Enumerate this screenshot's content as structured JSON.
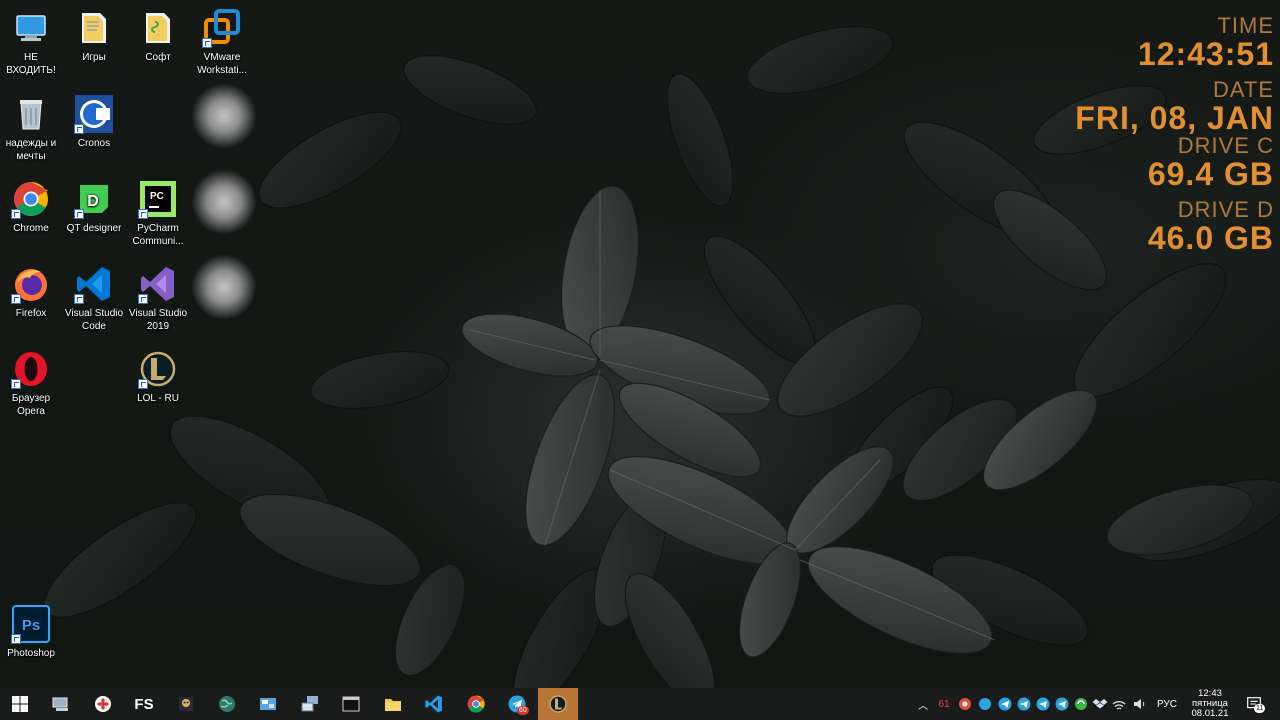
{
  "desktop": {
    "icons": [
      {
        "label": "НЕ ВХОДИТЬ!",
        "icon": "computer-icon"
      },
      {
        "label": "надежды и мечты",
        "icon": "recycle-bin-icon"
      },
      {
        "label": "Chrome",
        "icon": "chrome-icon"
      },
      {
        "label": "Firefox",
        "icon": "firefox-icon"
      },
      {
        "label": "Браузер Opera",
        "icon": "opera-icon"
      },
      {
        "label": "Photoshop",
        "icon": "photoshop-icon"
      },
      {
        "label": "Игры",
        "icon": "folder-icon"
      },
      {
        "label": "Cronos",
        "icon": "cronos-icon"
      },
      {
        "label": "QT designer",
        "icon": "qt-designer-icon"
      },
      {
        "label": "Visual Studio Code",
        "icon": "vscode-icon"
      },
      {
        "label": "Софт",
        "icon": "folder-icon"
      },
      {
        "label": "PyCharm Communi...",
        "icon": "pycharm-icon"
      },
      {
        "label": "Visual Studio 2019",
        "icon": "visual-studio-icon"
      },
      {
        "label": "LOL - RU",
        "icon": "league-of-legends-icon"
      },
      {
        "label": "VMware Workstati...",
        "icon": "vmware-icon"
      }
    ]
  },
  "widget": {
    "time_label": "TIME",
    "time_value": "12:43:51",
    "date_label": "DATE",
    "date_value": "FRI, 08, JAN",
    "drive_c_label": "DRIVE C",
    "drive_c_value": "69.4 GB",
    "drive_d_label": "DRIVE D",
    "drive_d_value": "46.0 GB"
  },
  "taskbar": {
    "fs_label": "FS",
    "telegram_badge": "60",
    "tray_count": "61",
    "language": "РУС",
    "clock_time": "12:43",
    "clock_day": "пятница",
    "clock_date": "08.01.21",
    "notification_count": "11"
  },
  "colors": {
    "widget_label": "#b2793b",
    "widget_value": "#e38f2d",
    "taskbar_bg": "#1a1c1b",
    "active_app": "#b87435"
  }
}
